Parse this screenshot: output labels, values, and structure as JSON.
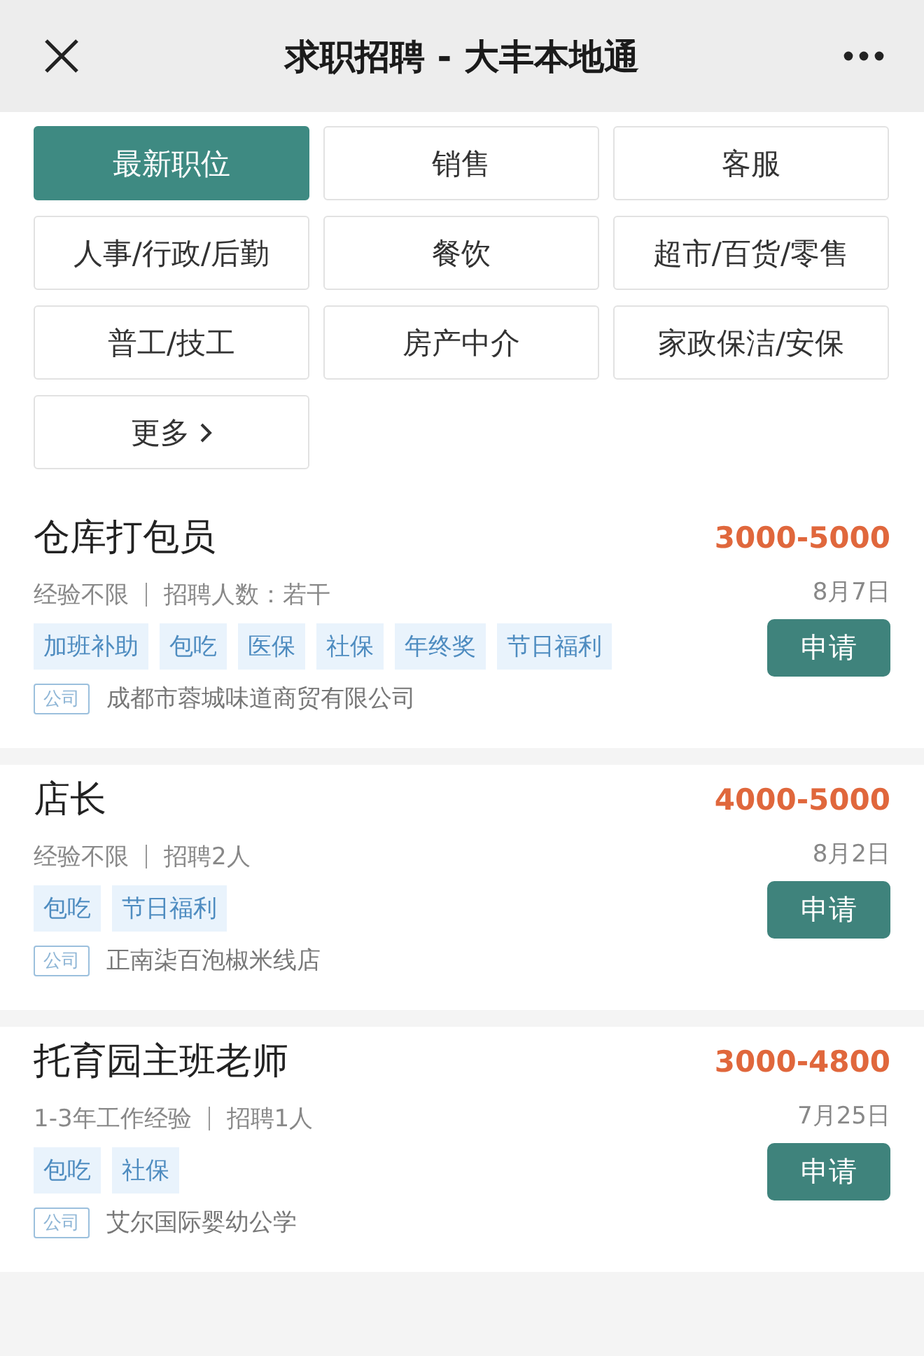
{
  "header": {
    "title": "求职招聘 - 大丰本地通"
  },
  "categories": [
    {
      "label": "最新职位",
      "selected": true,
      "kind": "plain"
    },
    {
      "label": "销售",
      "selected": false,
      "kind": "plain"
    },
    {
      "label": "客服",
      "selected": false,
      "kind": "plain"
    },
    {
      "label": "人事/行政/后勤",
      "selected": false,
      "kind": "plain"
    },
    {
      "label": "餐饮",
      "selected": false,
      "kind": "plain"
    },
    {
      "label": "超市/百货/零售",
      "selected": false,
      "kind": "plain"
    },
    {
      "label": "普工/技工",
      "selected": false,
      "kind": "plain"
    },
    {
      "label": "房产中介",
      "selected": false,
      "kind": "plain"
    },
    {
      "label": "家政保洁/安保",
      "selected": false,
      "kind": "plain"
    },
    {
      "label": "更多",
      "selected": false,
      "kind": "more"
    }
  ],
  "jobs": [
    {
      "title": "仓库打包员",
      "salary": "3000-5000",
      "experience": "经验不限",
      "headcount": "招聘人数：若干",
      "date": "8月7日",
      "apply": "申请",
      "tags": [
        "加班补助",
        "包吃",
        "医保",
        "社保",
        "年终奖",
        "节日福利"
      ],
      "company_label": "公司",
      "company": "成都市蓉城味道商贸有限公司"
    },
    {
      "title": "店长",
      "salary": "4000-5000",
      "experience": "经验不限",
      "headcount": "招聘2人",
      "date": "8月2日",
      "apply": "申请",
      "tags": [
        "包吃",
        "节日福利"
      ],
      "company_label": "公司",
      "company": "正南柒百泡椒米线店"
    },
    {
      "title": "托育园主班老师",
      "salary": "3000-4800",
      "experience": "1-3年工作经验",
      "headcount": "招聘1人",
      "date": "7月25日",
      "apply": "申请",
      "tags": [
        "包吃",
        "社保"
      ],
      "company_label": "公司",
      "company": "艾尔国际婴幼公学"
    }
  ]
}
